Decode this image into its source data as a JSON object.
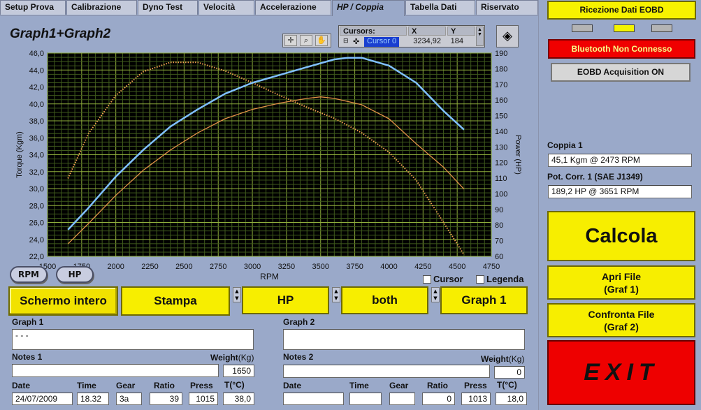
{
  "tabs": [
    "Setup Prova",
    "Calibrazione",
    "Dyno Test",
    "Velocità",
    "Accelerazione",
    "HP / Coppia",
    "Tabella Dati",
    "Riservato"
  ],
  "graph": {
    "title": "Graph1+Graph2",
    "xlabel": "RPM",
    "ylabel_left": "Torque (Kgm)",
    "ylabel_right": "Power (HP)",
    "x_ticks": [
      "1500",
      "1750",
      "2000",
      "2250",
      "2500",
      "2750",
      "3000",
      "3250",
      "3500",
      "3750",
      "4000",
      "4250",
      "4500",
      "4750"
    ],
    "y_left_ticks": [
      "46,0",
      "44,0",
      "42,0",
      "40,0",
      "38,0",
      "36,0",
      "34,0",
      "32,0",
      "30,0",
      "28,0",
      "26,0",
      "24,0",
      "22,0"
    ],
    "y_right_ticks": [
      "190",
      "180",
      "170",
      "160",
      "150",
      "140",
      "130",
      "120",
      "110",
      "100",
      "90",
      "80",
      "70",
      "60"
    ]
  },
  "chart_data": {
    "type": "line",
    "title": "Graph1+Graph2",
    "xlabel": "RPM",
    "ylabel": "Torque (Kgm)",
    "y2label": "Power (HP)",
    "xlim": [
      1500,
      4750
    ],
    "ylim": [
      22,
      46
    ],
    "y2lim": [
      60,
      190
    ],
    "grid": true,
    "series": [
      {
        "axis": "left",
        "color": "#f0a050",
        "style": "dotted",
        "x": [
          1650,
          1800,
          2000,
          2200,
          2400,
          2600,
          2800,
          3000,
          3200,
          3400,
          3600,
          3800,
          4000,
          4200,
          4400,
          4550
        ],
        "y": [
          31.2,
          36.5,
          41.0,
          43.8,
          44.9,
          44.9,
          43.9,
          42.5,
          41.0,
          39.6,
          38.3,
          36.6,
          34.3,
          31.0,
          26.0,
          22.2
        ]
      },
      {
        "axis": "right",
        "color": "#e09048",
        "style": "solid",
        "x": [
          1650,
          1800,
          2000,
          2200,
          2400,
          2600,
          2800,
          3000,
          3200,
          3400,
          3500,
          3600,
          3800,
          4000,
          4200,
          4400,
          4550
        ],
        "y": [
          68,
          81,
          99,
          115,
          128,
          139,
          148,
          154,
          158,
          161,
          162,
          161,
          157,
          148,
          132,
          117,
          103
        ]
      },
      {
        "axis": "right",
        "color": "#80c0ff",
        "style": "solid",
        "x": [
          1650,
          1800,
          2000,
          2200,
          2400,
          2600,
          2800,
          3000,
          3200,
          3400,
          3600,
          3700,
          3800,
          4000,
          4200,
          4400,
          4550
        ],
        "y": [
          77,
          91,
          111,
          128,
          143,
          154,
          164,
          171,
          176,
          181,
          186,
          187,
          187,
          182,
          171,
          153,
          141
        ]
      }
    ]
  },
  "cursors": {
    "header": "Cursors:",
    "x_header": "X",
    "y_header": "Y",
    "name": "Cursor 0",
    "x": "3234,92",
    "y": "184"
  },
  "buttons": {
    "rpm": "RPM",
    "hp": "HP",
    "cursor": "Cursor",
    "legenda": "Legenda",
    "schermo": "Schermo intero",
    "stampa": "Stampa",
    "sel1": "HP",
    "sel2": "both",
    "sel3": "Graph 1"
  },
  "form": {
    "graph1_label": "Graph 1",
    "graph1_value": "- - -",
    "graph2_label": "Graph 2",
    "graph2_value": "",
    "notes1_label": "Notes 1",
    "notes2_label": "Notes 2",
    "weight_label": "Weight",
    "weight_unit": "(Kg)",
    "weight1": "1650",
    "weight2": "0",
    "headers": [
      "Date",
      "Time",
      "Gear",
      "Ratio",
      "Press",
      "T(°C)"
    ],
    "row1": [
      "24/07/2009",
      "18.32",
      "3a",
      "39",
      "1015",
      "38,0"
    ],
    "row2": [
      "",
      "",
      "",
      "0",
      "1013",
      "18,0"
    ]
  },
  "side": {
    "ricezione": "Ricezione Dati EOBD",
    "bluetooth": "Bluetooth Non Connesso",
    "acq": "EOBD Acquisition ON",
    "coppia_label": "Coppia 1",
    "coppia_value": "45,1 Kgm  @ 2473  RPM",
    "pot_label": "Pot. Corr. 1 (SAE J1349)",
    "pot_value": "189,2 HP   @ 3651  RPM",
    "calcola": "Calcola",
    "apri1": "Apri File",
    "apri2": "(Graf 1)",
    "conf1": "Confronta File",
    "conf2": "(Graf 2)",
    "exit": "EXIT"
  }
}
